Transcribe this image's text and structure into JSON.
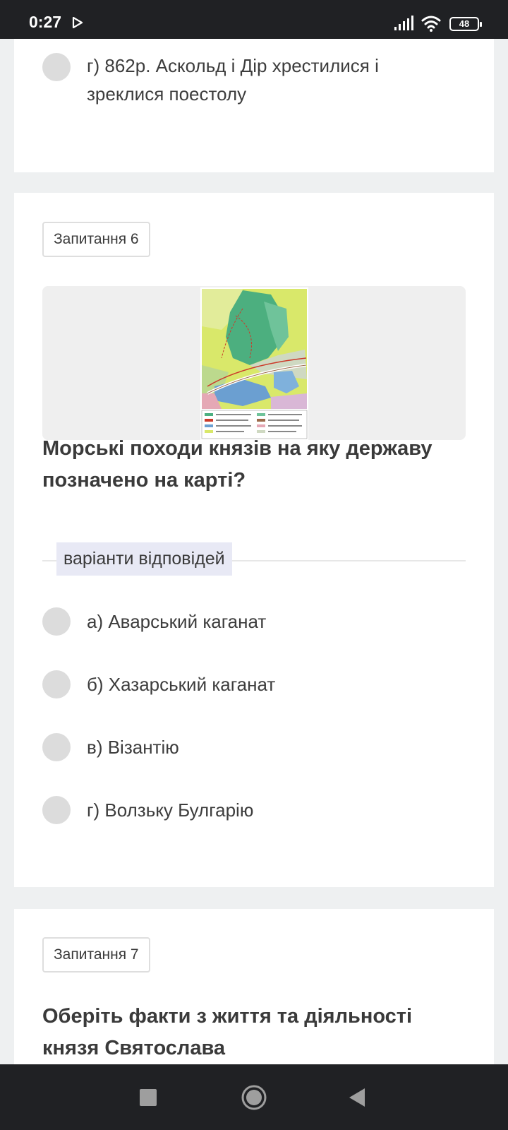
{
  "status_bar": {
    "time": "0:27",
    "battery": "48"
  },
  "previous_question": {
    "option_g": "г) 862р. Аскольд і Дір хрестилися і зреклися поестолу"
  },
  "question6": {
    "badge": "Запитання 6",
    "text": "Морські походи князів на яку державу позначено на карті?",
    "answers_label": "варіанти відповідей",
    "options": [
      {
        "label": "а) Аварський каганат"
      },
      {
        "label": "б) Хазарський каганат"
      },
      {
        "label": "в) Візантію"
      },
      {
        "label": "г) Волзьку Булгарію"
      }
    ]
  },
  "question7": {
    "badge": "Запитання 7",
    "text": "Оберіть факти з життя та діяльності князя Святослава"
  },
  "icons": {
    "play": "play-store-notification-icon",
    "signal": "cellular-signal-icon",
    "wifi": "wifi-icon",
    "battery": "battery-icon",
    "nav_recents": "recents-square-icon",
    "nav_home": "home-circle-icon",
    "nav_back": "back-triangle-icon"
  }
}
